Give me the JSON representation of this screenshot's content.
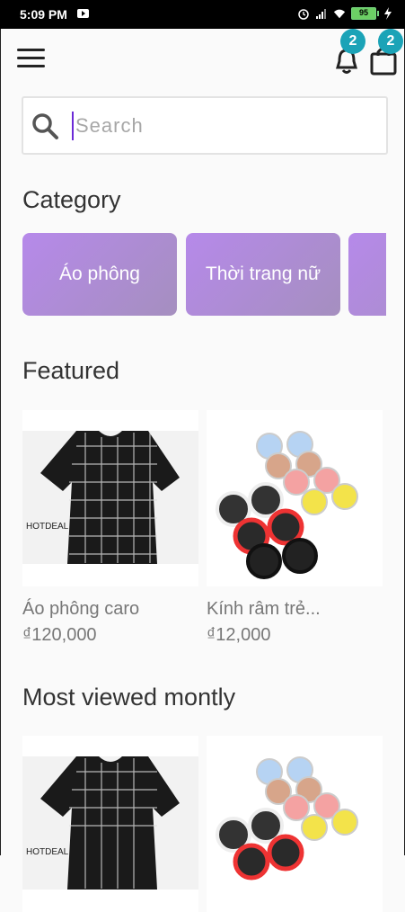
{
  "status": {
    "time": "5:09 PM",
    "battery": "95"
  },
  "header": {
    "notifications": "2",
    "cart_count": "2"
  },
  "search": {
    "placeholder": "Search"
  },
  "sections": {
    "category": "Category",
    "featured": "Featured",
    "most_viewed": "Most viewed montly"
  },
  "categories": [
    {
      "label": "Áo phông"
    },
    {
      "label": "Thời trang nữ"
    },
    {
      "label": ""
    }
  ],
  "featured": [
    {
      "name": "Áo phông caro",
      "price": "₫120,000",
      "watermark": "HOTDEAL"
    },
    {
      "name": "Kính râm trẻ...",
      "price": "₫12,000"
    }
  ],
  "most_viewed": [
    {
      "watermark": "HOTDEAL"
    },
    {}
  ],
  "colors": {
    "accent": "#1ba3b7",
    "category": "#b689ea",
    "caret": "#6b2ad7"
  }
}
